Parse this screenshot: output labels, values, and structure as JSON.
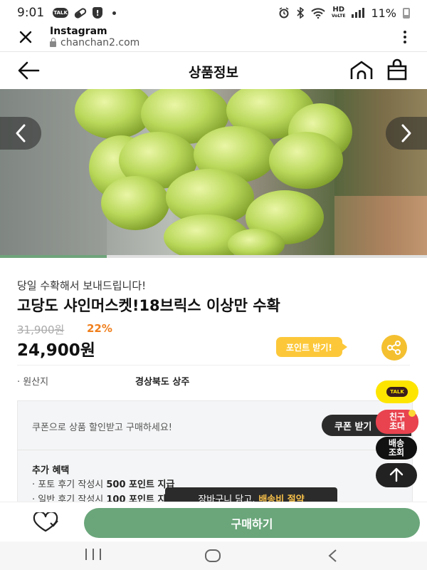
{
  "status_bar": {
    "time": "9:01",
    "talk_label": "TALK",
    "alert_glyph": "!",
    "hd_label": "HD",
    "hd_sub": "VoLTE",
    "battery": "11%",
    "icons": [
      "talk-icon",
      "pill-icon",
      "alert-shield-icon",
      "dot-icon",
      "alarm-icon",
      "bluetooth-icon",
      "wifi-icon",
      "hd-voice-icon",
      "signal-icon",
      "battery-icon"
    ]
  },
  "browser": {
    "title": "Instagram",
    "url": "chanchan2.com"
  },
  "header": {
    "title": "상품정보"
  },
  "carousel": {
    "prev_glyph": "<",
    "next_glyph": ">",
    "progress": 0.25
  },
  "product": {
    "subtitle": "당일 수확해서 보내드립니다!",
    "name": "고당도 샤인머스켓!18브릭스 이상만 수확",
    "original_price": "31,900원",
    "discount": "22%",
    "price": "24,900원",
    "points_label": "포인트 받기!",
    "origin_label": "· 원산지",
    "origin_value": "경상북도 상주"
  },
  "coupon": {
    "text": "쿠폰으로 상품 할인받고 구매하세요!",
    "button": "쿠폰 받기",
    "benefit_title": "추가 혜택",
    "benefit_photo_prefix": "· 포토 후기 작성시 ",
    "benefit_photo_bold": "500 포인트 지급",
    "benefit_normal_prefix": "· 일반 후기 작성시 ",
    "benefit_normal_bold": "100 포인트 지급"
  },
  "fabs": {
    "kakao_label": "TALK",
    "invite_line1": "친구",
    "invite_line2": "초대",
    "delivery_line1": "배송",
    "delivery_line2": "조회"
  },
  "toast": {
    "prefix": "장바구니 담고,",
    "highlight": "배송비 절약"
  },
  "bottom": {
    "buy_label": "구매하기"
  },
  "colors": {
    "accent_green": "#6aa67a",
    "discount_orange": "#f07f1d",
    "points_yellow": "#fcc83a",
    "kakao_yellow": "#fee500",
    "invite_red": "#e8434f"
  }
}
